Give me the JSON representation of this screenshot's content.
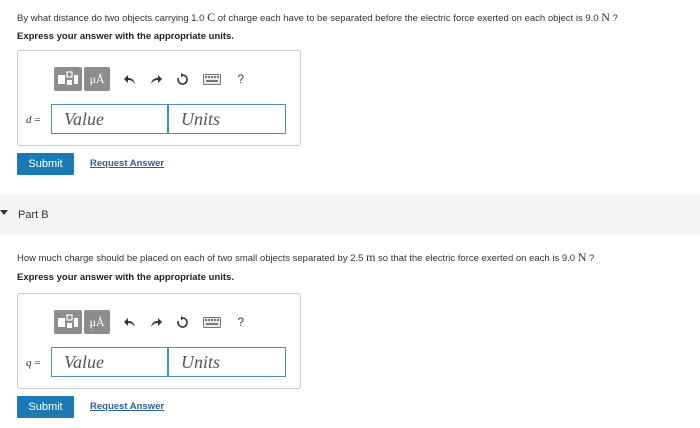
{
  "partA": {
    "question": {
      "pre": "By what distance do two objects carrying 1.0 ",
      "unit1": "C",
      "mid": " of charge each have to be separated before the electric force exerted on each object is 9.0 ",
      "unit2": "N",
      "post": " ?"
    },
    "instruction": "Express your answer with the appropriate units.",
    "toolbar": {
      "template_icon": "fraction-template-icon",
      "mu_label": "μÅ",
      "undo_icon": "undo-icon",
      "redo_icon": "redo-icon",
      "reset_icon": "reset-icon",
      "keyboard_icon": "keyboard-icon",
      "help_label": "?"
    },
    "variable": "d",
    "equals": " =",
    "value_placeholder": "Value",
    "units_placeholder": "Units",
    "submit_label": "Submit",
    "request_label": "Request Answer"
  },
  "partB": {
    "title": "Part B",
    "question": {
      "pre": "How much charge should be placed on each of two small objects separated by 2.5 ",
      "unit1": "m",
      "mid": " so that the electric force exerted on each is 9.0 ",
      "unit2": "N",
      "post": " ?"
    },
    "instruction": "Express your answer with the appropriate units.",
    "toolbar": {
      "mu_label": "μÅ",
      "help_label": "?"
    },
    "variable": "q",
    "equals": " =",
    "value_placeholder": "Value",
    "units_placeholder": "Units",
    "submit_label": "Submit",
    "request_label": "Request Answer"
  },
  "colors": {
    "submit_bg": "#1a7bb4",
    "link": "#2b5f9c",
    "field_border": "#4a90c6",
    "toolbar_grey": "#8d8d8d"
  }
}
